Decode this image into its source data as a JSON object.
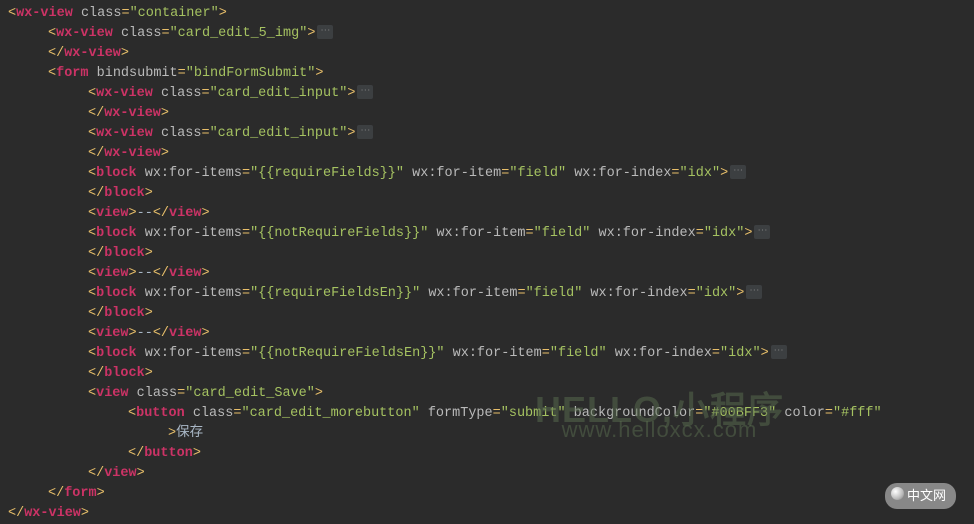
{
  "fold_marker": "⋯",
  "watermark": {
    "line1": "HELLO,小程序",
    "line2": "www.helloxcx.com"
  },
  "badge": "中文网",
  "code": {
    "l1": {
      "el": "wx-view",
      "a1": "class",
      "v1": "container"
    },
    "l2": {
      "el": "wx-view",
      "a1": "class",
      "v1": "card_edit_5_img"
    },
    "l3": {
      "el": "wx-view"
    },
    "l4": {
      "el": "form",
      "a1": "bindsubmit",
      "v1": "bindFormSubmit"
    },
    "l5": {
      "el": "wx-view",
      "a1": "class",
      "v1": "card_edit_input"
    },
    "l6": {
      "el": "wx-view"
    },
    "l7": {
      "el": "wx-view",
      "a1": "class",
      "v1": "card_edit_input"
    },
    "l8": {
      "el": "wx-view"
    },
    "l9": {
      "el": "block",
      "a1": "wx:for-items",
      "v1": "{{requireFields}}",
      "a2": "wx:for-item",
      "v2": "field",
      "a3": "wx:for-index",
      "v3": "idx"
    },
    "l10": {
      "el": "block"
    },
    "l11": {
      "el": "view",
      "text": "--"
    },
    "l12": {
      "el": "block",
      "a1": "wx:for-items",
      "v1": "{{notRequireFields}}",
      "a2": "wx:for-item",
      "v2": "field",
      "a3": "wx:for-index",
      "v3": "idx"
    },
    "l13": {
      "el": "block"
    },
    "l14": {
      "el": "view",
      "text": "--"
    },
    "l15": {
      "el": "block",
      "a1": "wx:for-items",
      "v1": "{{requireFieldsEn}}",
      "a2": "wx:for-item",
      "v2": "field",
      "a3": "wx:for-index",
      "v3": "idx"
    },
    "l16": {
      "el": "block"
    },
    "l17": {
      "el": "view",
      "text": "--"
    },
    "l18": {
      "el": "block",
      "a1": "wx:for-items",
      "v1": "{{notRequireFieldsEn}}",
      "a2": "wx:for-item",
      "v2": "field",
      "a3": "wx:for-index",
      "v3": "idx"
    },
    "l19": {
      "el": "block"
    },
    "l20": {
      "el": "view",
      "a1": "class",
      "v1": "card_edit_Save"
    },
    "l21": {
      "el": "button",
      "a1": "class",
      "v1": "card_edit_morebutton",
      "a2": "formType",
      "v2": "submit",
      "a3": "backgroundColor",
      "v3": "#00BFF3",
      "a4": "color",
      "v4": "#fff"
    },
    "l22": {
      "text": "保存"
    },
    "l23": {
      "el": "button"
    },
    "l24": {
      "el": "view"
    },
    "l25": {
      "el": "form"
    },
    "l26": {
      "el": "wx-view"
    }
  }
}
